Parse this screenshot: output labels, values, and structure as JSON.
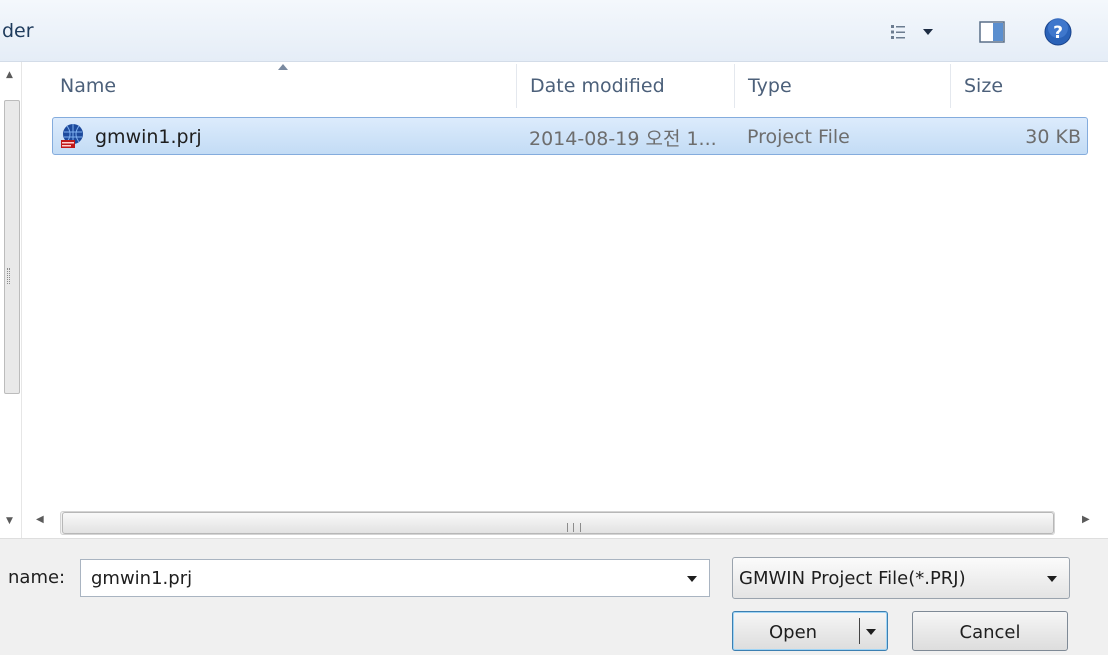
{
  "toolbar": {
    "path_text": "der",
    "icons": [
      "view-options-icon",
      "dropdown-arrow-icon",
      "preview-pane-icon",
      "help-icon"
    ]
  },
  "columns": [
    "Name",
    "Date modified",
    "Type",
    "Size"
  ],
  "files": [
    {
      "name": "gmwin1.prj",
      "date_modified": "2014-08-19 오전 1...",
      "type": "Project File",
      "size": "30 KB",
      "icon": "gmwin-project-icon"
    }
  ],
  "footer": {
    "filename_label": "name:",
    "filename_value": "gmwin1.prj",
    "filter_value": "GMWIN Project File(*.PRJ)",
    "open_label": "Open",
    "cancel_label": "Cancel"
  },
  "colors": {
    "selection": "#cce4f7",
    "selection_border": "#84acdd",
    "help_icon": "#2a62b8"
  }
}
